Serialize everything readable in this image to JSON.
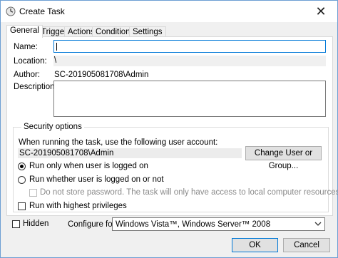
{
  "window": {
    "title": "Create Task",
    "close_glyph": "✕"
  },
  "tabs": [
    {
      "label": "General"
    },
    {
      "label": "Triggers"
    },
    {
      "label": "Actions"
    },
    {
      "label": "Conditions"
    },
    {
      "label": "Settings"
    }
  ],
  "general": {
    "name_label": "Name:",
    "name_value": "",
    "location_label": "Location:",
    "location_value": "\\",
    "author_label": "Author:",
    "author_value": "SC-201905081708\\Admin",
    "description_label": "Description:",
    "description_value": ""
  },
  "security": {
    "title": "Security options",
    "account_prompt": "When running the task, use the following user account:",
    "account_value": "SC-201905081708\\Admin",
    "change_button": "Change User or Group...",
    "run_logged_on": "Run only when user is logged on",
    "run_whether": "Run whether user is logged on or not",
    "no_store_password": "Do not store password.  The task will only have access to local computer resources.",
    "highest_privileges": "Run with highest privileges",
    "selected_option": "run_logged_on"
  },
  "bottom": {
    "hidden_label": "Hidden",
    "configure_label": "Configure for:",
    "configure_value": "Windows Vista™, Windows Server™ 2008",
    "ok_button": "OK",
    "cancel_button": "Cancel"
  },
  "colors": {
    "accent": "#0078d7",
    "border": "#7a7a7a"
  }
}
